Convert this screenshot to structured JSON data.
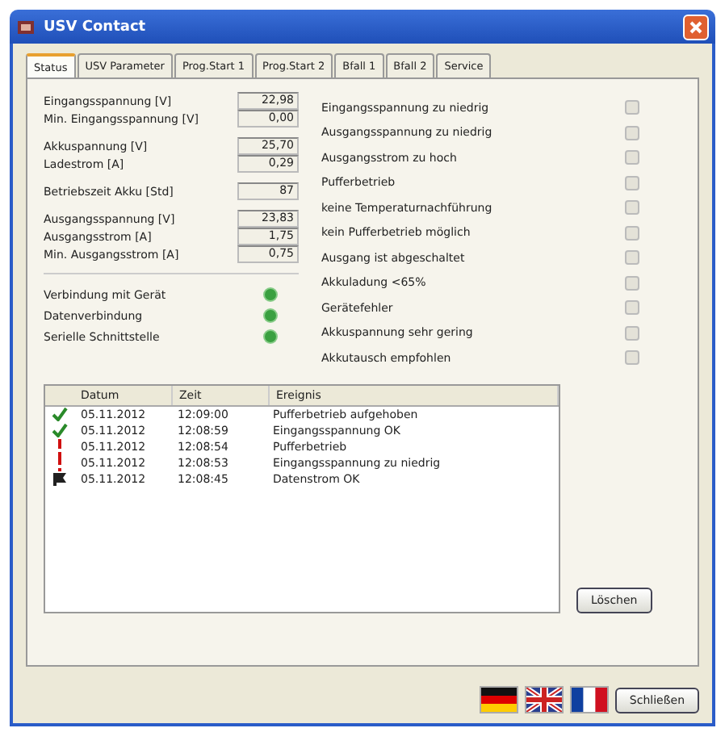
{
  "window": {
    "title": "USV Contact"
  },
  "tabs": [
    {
      "label": "Status",
      "selected": true
    },
    {
      "label": "USV Parameter",
      "selected": false
    },
    {
      "label": "Prog.Start 1",
      "selected": false
    },
    {
      "label": "Prog.Start 2",
      "selected": false
    },
    {
      "label": "Bfall 1",
      "selected": false
    },
    {
      "label": "Bfall 2",
      "selected": false
    },
    {
      "label": "Service",
      "selected": false
    }
  ],
  "measurement_groups": [
    [
      {
        "label": "Eingangsspannung [V]",
        "value": "22,98"
      },
      {
        "label": "Min. Eingangsspannung [V]",
        "value": "0,00"
      }
    ],
    [
      {
        "label": "Akkuspannung [V]",
        "value": "25,70"
      },
      {
        "label": "Ladestrom [A]",
        "value": "0,29"
      }
    ],
    [
      {
        "label": "Betriebszeit Akku [Std]",
        "value": "87"
      }
    ],
    [
      {
        "label": "Ausgangsspannung [V]",
        "value": "23,83"
      },
      {
        "label": "Ausgangsstrom [A]",
        "value": "1,75"
      },
      {
        "label": "Min. Ausgangsstrom [A]",
        "value": "0,75"
      }
    ]
  ],
  "connection_status": [
    {
      "label": "Verbindung mit Gerät",
      "on": true
    },
    {
      "label": "Datenverbindung",
      "on": true
    },
    {
      "label": "Serielle Schnittstelle",
      "on": true
    }
  ],
  "alarms": [
    {
      "label": "Eingangsspannung zu niedrig",
      "on": false
    },
    {
      "label": "Ausgangsspannung zu niedrig",
      "on": false
    },
    {
      "label": "Ausgangsstrom zu hoch",
      "on": false
    },
    {
      "label": "Pufferbetrieb",
      "on": false
    },
    {
      "label": "keine Temperaturnachführung",
      "on": false
    },
    {
      "label": "kein Pufferbetrieb möglich",
      "on": false
    },
    {
      "label": "Ausgang ist abgeschaltet",
      "on": false
    },
    {
      "label": "Akkuladung <65%",
      "on": false
    },
    {
      "label": "Gerätefehler",
      "on": false
    },
    {
      "label": "Akkuspannung sehr gering",
      "on": false
    },
    {
      "label": "Akkutausch empfohlen",
      "on": false
    }
  ],
  "events": {
    "columns": [
      "Datum",
      "Zeit",
      "Ereignis"
    ],
    "rows": [
      {
        "kind": "ok",
        "date": "05.11.2012",
        "time": "12:09:00",
        "event": "Pufferbetrieb aufgehoben"
      },
      {
        "kind": "ok",
        "date": "05.11.2012",
        "time": "12:08:59",
        "event": "Eingangsspannung OK"
      },
      {
        "kind": "error",
        "date": "05.11.2012",
        "time": "12:08:54",
        "event": "Pufferbetrieb"
      },
      {
        "kind": "error",
        "date": "05.11.2012",
        "time": "12:08:53",
        "event": "Eingangsspannung zu niedrig"
      },
      {
        "kind": "info",
        "date": "05.11.2012",
        "time": "12:08:45",
        "event": "Datenstrom OK"
      }
    ]
  },
  "clear_button": "Löschen",
  "languages": [
    {
      "kind": "de"
    },
    {
      "kind": "uk"
    },
    {
      "kind": "fr"
    }
  ],
  "close_button": "Schließen"
}
